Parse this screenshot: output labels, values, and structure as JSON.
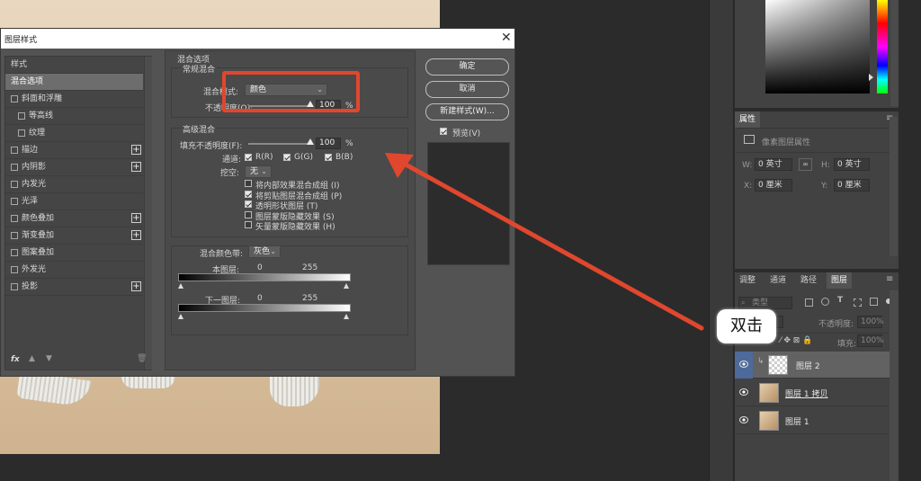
{
  "dialog": {
    "title": "图层样式",
    "close": "✕"
  },
  "style_list": {
    "header": "样式",
    "items": [
      {
        "label": "混合选项",
        "selected": true,
        "checkbox": false,
        "plus": false
      },
      {
        "label": "斜面和浮雕",
        "checkbox": true,
        "plus": false
      },
      {
        "label": "等高线",
        "checkbox": true,
        "plus": false,
        "indent": true
      },
      {
        "label": "纹理",
        "checkbox": true,
        "plus": false,
        "indent": true
      },
      {
        "label": "描边",
        "checkbox": true,
        "plus": true
      },
      {
        "label": "内阴影",
        "checkbox": true,
        "plus": true
      },
      {
        "label": "内发光",
        "checkbox": true,
        "plus": false
      },
      {
        "label": "光泽",
        "checkbox": true,
        "plus": false
      },
      {
        "label": "颜色叠加",
        "checkbox": true,
        "plus": true
      },
      {
        "label": "渐变叠加",
        "checkbox": true,
        "plus": true
      },
      {
        "label": "图案叠加",
        "checkbox": true,
        "plus": false
      },
      {
        "label": "外发光",
        "checkbox": true,
        "plus": false
      },
      {
        "label": "投影",
        "checkbox": true,
        "plus": true
      }
    ],
    "footer_fx": "fx"
  },
  "blend": {
    "section_title": "混合选项",
    "general": {
      "title": "常规混合",
      "mode_label": "混合模式:",
      "mode_value": "颜色",
      "opacity_label": "不透明度(O):",
      "opacity_value": "100",
      "opacity_unit": "%"
    },
    "advanced": {
      "title": "高级混合",
      "fill_label": "填充不透明度(F):",
      "fill_value": "100",
      "fill_unit": "%",
      "channels_label": "通道:",
      "channel_r": "R(R)",
      "channel_g": "G(G)",
      "channel_b": "B(B)",
      "knockout_label": "挖空:",
      "knockout_value": "无",
      "options": [
        {
          "label": "将内部效果混合成组 (I)",
          "checked": false
        },
        {
          "label": "将剪贴图层混合成组 (P)",
          "checked": true
        },
        {
          "label": "透明形状图层 (T)",
          "checked": true
        },
        {
          "label": "图层蒙版隐藏效果 (S)",
          "checked": false
        },
        {
          "label": "矢量蒙版隐藏效果 (H)",
          "checked": false
        }
      ]
    },
    "blend_if": {
      "label": "混合颜色带:",
      "value": "灰色",
      "this_layer_label": "本图层:",
      "this_min": "0",
      "this_max": "255",
      "under_layer_label": "下一图层:",
      "under_min": "0",
      "under_max": "255"
    }
  },
  "buttons": {
    "ok": "确定",
    "cancel": "取消",
    "new_style": "新建样式(W)...",
    "preview_label": "预览(V)"
  },
  "annotation": {
    "label": "双击",
    "color": "#e0472e"
  },
  "properties": {
    "tab": "属性",
    "subtitle": "像素图层属性",
    "w_label": "W:",
    "w_value": "0 英寸",
    "h_label": "H:",
    "h_value": "0 英寸",
    "x_label": "X:",
    "x_value": "0 厘米",
    "y_label": "Y:",
    "y_value": "0 厘米"
  },
  "layers_panel": {
    "tabs": [
      "调整",
      "通道",
      "路径",
      "图层"
    ],
    "kind_filter": "类型",
    "opacity_label": "不透明度:",
    "opacity_value": "100%",
    "fill_label": "填充:",
    "fill_value": "100%",
    "layers": [
      {
        "name": "图层 2",
        "selected": true,
        "transparent": true
      },
      {
        "name": "图层 1 拷贝",
        "selected": false
      },
      {
        "name": "图层 1",
        "selected": false
      }
    ]
  }
}
